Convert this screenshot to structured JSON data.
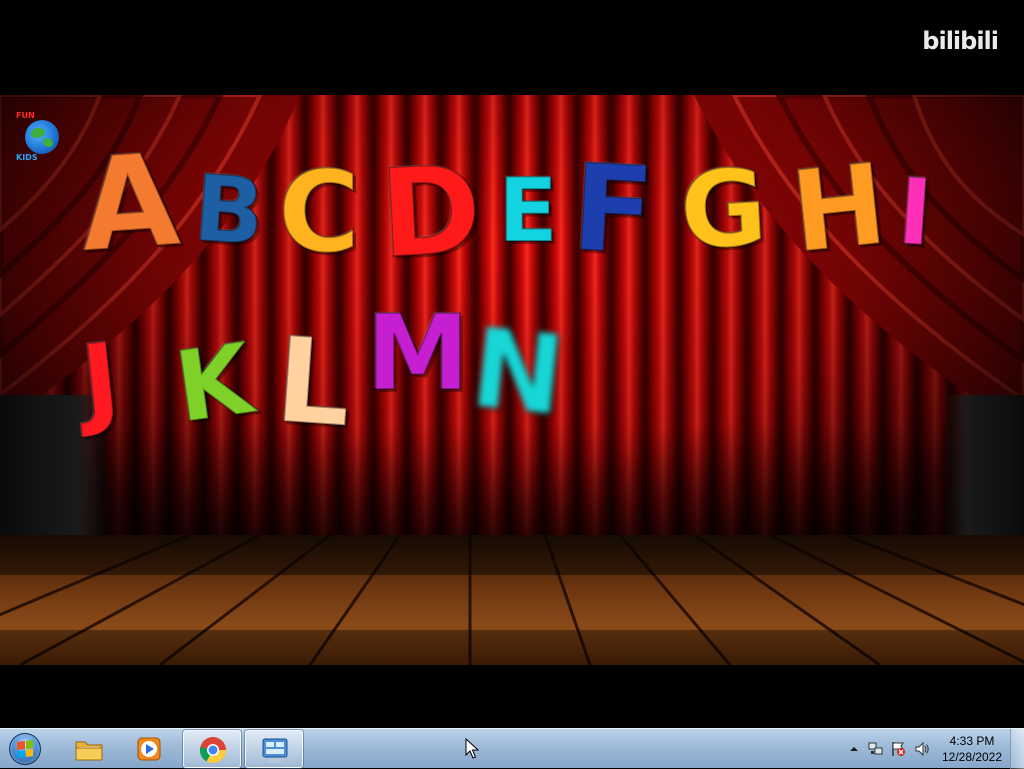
{
  "video": {
    "watermark": "bilibili",
    "channel_logo": {
      "top_left": "FUN",
      "top_right": "",
      "bottom_left": "KIDS",
      "bottom_right": "",
      "icon": "globe-icon"
    },
    "letters_row1": [
      {
        "char": "A",
        "color": "#f47a2f"
      },
      {
        "char": "B",
        "color": "#1e5fa3"
      },
      {
        "char": "C",
        "color": "#ffb41f"
      },
      {
        "char": "D",
        "color": "#ff1a1a"
      },
      {
        "char": "E",
        "color": "#13d3e0"
      },
      {
        "char": "F",
        "color": "#1d3fae"
      },
      {
        "char": "G",
        "color": "#ffc21a"
      },
      {
        "char": "H",
        "color": "#ff9a22"
      },
      {
        "char": "I",
        "color": "#ff2fb8"
      }
    ],
    "letters_row2": [
      {
        "char": "J",
        "color": "#ff1a22"
      },
      {
        "char": "K",
        "color": "#7fd12a"
      },
      {
        "char": "L",
        "color": "#ffd2a0"
      },
      {
        "char": "M",
        "color": "#c51fd1"
      },
      {
        "char": "N",
        "color": "#18d6d6"
      }
    ],
    "colors": {
      "curtain": "#d40d0d",
      "floor": "#8a4a18"
    }
  },
  "taskbar": {
    "start": {
      "icon": "windows-start-icon"
    },
    "pinned": [
      {
        "name": "explorer",
        "icon": "folder-icon",
        "active": false
      },
      {
        "name": "media-player",
        "icon": "media-player-icon",
        "active": false
      },
      {
        "name": "chrome",
        "icon": "chrome-icon",
        "active": true
      },
      {
        "name": "control-panel",
        "icon": "control-panel-icon",
        "active": true
      }
    ],
    "tray": {
      "icons": [
        "show-hidden-icons-icon",
        "network-icon",
        "action-center-icon",
        "volume-icon"
      ],
      "time": "4:33 PM",
      "date": "12/28/2022"
    }
  }
}
